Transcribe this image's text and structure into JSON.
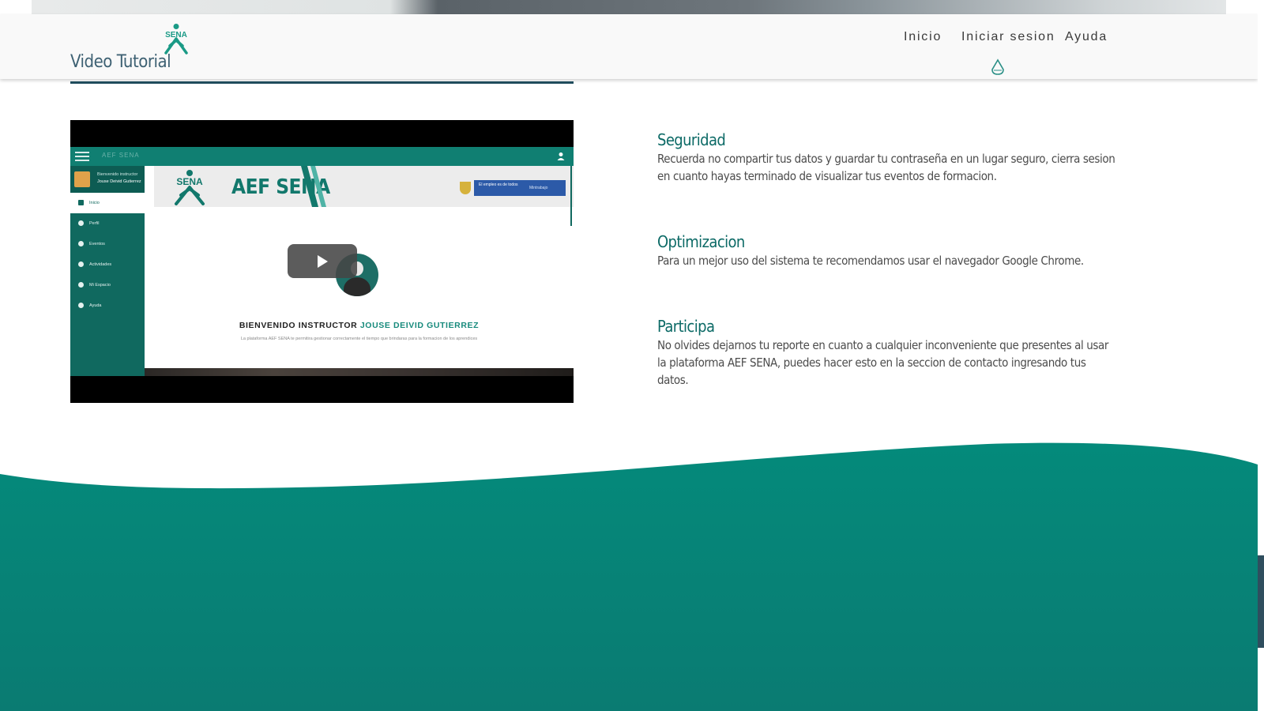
{
  "navbar": {
    "logo_text": "SENA",
    "page_title": "Video Tutorial",
    "links": [
      "Inicio",
      "Iniciar sesion",
      "Ayuda"
    ]
  },
  "video": {
    "app_name": "AEF SENA",
    "welcome_small": "Bienvenido instructor",
    "user_name": "Jouse Deivid Gutierrez",
    "menu": [
      "Inicio",
      "Perfil",
      "Eventos",
      "Actividades",
      "Mi Espacio",
      "Ayuda"
    ],
    "banner_title": "AEF SENA",
    "gov_text": "El empleo es de todos",
    "gov_ministry": "Mintrabajo",
    "welcome_title": "BIENVENIDO INSTRUCTOR",
    "welcome_name": "JOUSE DEIVID GUTIERREZ",
    "description": "La plataforma AEF SENA te permitira gestionar correctamente el tiempo que brindaras para la formacion de los aprendices"
  },
  "tips": [
    {
      "title": "Seguridad",
      "text": "Recuerda no compartir tus datos y guardar tu contraseña en un lugar seguro, cierra sesion en cuanto hayas terminado de visualizar tus eventos de formacion."
    },
    {
      "title": "Optimizacion",
      "text": "Para un mejor uso del sistema te recomendamos usar el navegador Google Chrome."
    },
    {
      "title": "Participa",
      "text": "No olvides dejarnos tu reporte en cuanto a cualquier inconveniente que presentes al usar la plataforma AEF SENA, puedes hacer esto en la seccion de contacto ingresando tus datos."
    }
  ],
  "colors": {
    "brand_teal": "#0a8a7c",
    "title_dark": "#3e6173",
    "tip_title": "#0c6a66"
  }
}
